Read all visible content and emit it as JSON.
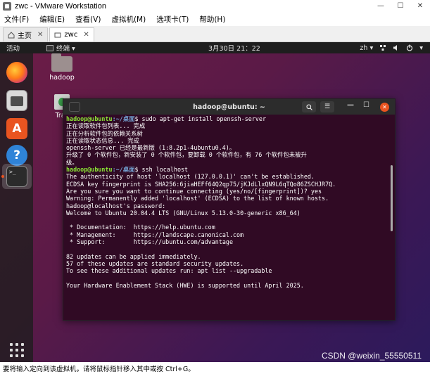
{
  "window": {
    "title": "zwc - VMware Workstation"
  },
  "menu": [
    "文件(F)",
    "编辑(E)",
    "查看(V)",
    "虚拟机(M)",
    "选项卡(T)",
    "帮助(H)"
  ],
  "tabs": [
    {
      "label": "主页"
    },
    {
      "label": "zwc"
    }
  ],
  "topbar": {
    "activities": "活动",
    "app_menu": "终端 ▾",
    "clock": "3月30日  21：22",
    "lang": "zh ▾"
  },
  "desktop": {
    "home_label": "hadoop",
    "trash_label": "Tras"
  },
  "terminal": {
    "title": "hadoop@ubuntu: ~",
    "lines": [
      {
        "user": "hadoop@ubuntu",
        "path": ":~/桌面",
        "cmd": "$ sudo apt-get install openssh-server"
      },
      {
        "text": "正在读取软件包列表... 完成"
      },
      {
        "text": "正在分析软件包的依赖关系树"
      },
      {
        "text": "正在读取状态信息... 完成"
      },
      {
        "text": "openssh-server 已经是最新版 (1:8.2p1-4ubuntu0.4)。"
      },
      {
        "text": "升级了 0 个软件包，新安装了 0 个软件包，要卸载 0 个软件包，有 76 个软件包未被升"
      },
      {
        "text": "级。"
      },
      {
        "user": "hadoop@ubuntu",
        "path": ":~/桌面",
        "cmd": "$ ssh localhost"
      },
      {
        "text": "The authenticity of host 'localhost (127.0.0.1)' can't be established."
      },
      {
        "text": "ECDSA key fingerprint is SHA256:6jiaHEFf64Q2qp75/jKJdLlxQN9L6qTQo86ZSCHJR7Q."
      },
      {
        "text": "Are you sure you want to continue connecting (yes/no/[fingerprint])? yes"
      },
      {
        "text": "Warning: Permanently added 'localhost' (ECDSA) to the list of known hosts."
      },
      {
        "text": "hadoop@localhost's password:"
      },
      {
        "text": "Welcome to Ubuntu 20.04.4 LTS (GNU/Linux 5.13.0-30-generic x86_64)"
      },
      {
        "text": ""
      },
      {
        "text": " * Documentation:  https://help.ubuntu.com"
      },
      {
        "text": " * Management:     https://landscape.canonical.com"
      },
      {
        "text": " * Support:        https://ubuntu.com/advantage"
      },
      {
        "text": ""
      },
      {
        "text": "82 updates can be applied immediately."
      },
      {
        "text": "57 of these updates are standard security updates."
      },
      {
        "text": "To see these additional updates run: apt list --upgradable"
      },
      {
        "text": ""
      },
      {
        "text": "Your Hardware Enablement Stack (HWE) is supported until April 2025."
      }
    ]
  },
  "status": {
    "text": "要将输入定向到该虚拟机，请将鼠标指针移入其中或按 Ctrl+G。"
  },
  "watermark": "CSDN @weixin_55550511",
  "colors": {
    "ubuntu_orange": "#e95420",
    "terminal_bg": "#300a24",
    "prompt_user": "#8ae234",
    "prompt_path": "#729fcf"
  }
}
